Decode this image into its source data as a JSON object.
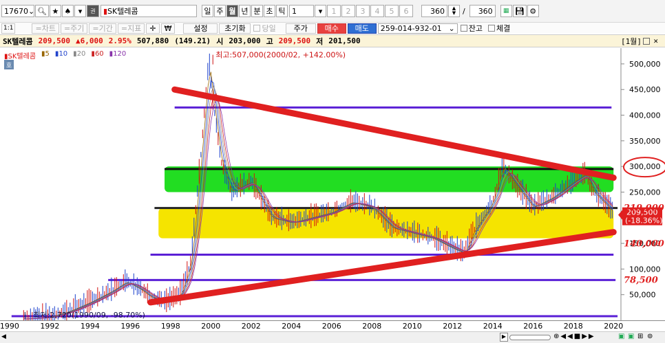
{
  "toolbar": {
    "code": "17670",
    "stock_name": "SK텔레콤",
    "period_tabs": [
      "일",
      "주",
      "월",
      "년",
      "분",
      "초",
      "틱"
    ],
    "active_period": "월",
    "interval_value": "1",
    "page_numbers": [
      "1",
      "2",
      "3",
      "4",
      "5",
      "6"
    ],
    "count_value": "360",
    "count_total": "360",
    "slash": "/"
  },
  "toolbar2": {
    "page": "1:1",
    "chart_btn": "=차트",
    "period_btn": "=주기",
    "range_btn": "=기간",
    "indicator_btn": "=지표",
    "settings_btn": "설정",
    "reset_btn": "초기화",
    "today_label": "당일",
    "price_btn": "주가",
    "buy_btn": "매수",
    "sell_btn": "매도",
    "account": "259-014-932-01",
    "balance_label": "잔고",
    "filled_label": "체결"
  },
  "quote": {
    "name": "SK텔레콤",
    "price": "209,500",
    "change": "▲6,000",
    "rate": "2.95%",
    "volume": "507,880",
    "volume_ratio": "(149.21)",
    "open_label": "시",
    "open": "203,000",
    "high_label": "고",
    "high": "209,500",
    "low_label": "저",
    "low": "201,500",
    "window_label": "[1월]"
  },
  "legend": {
    "name": "SK텔레콤",
    "ma": [
      "5",
      "10",
      "20",
      "60",
      "120"
    ]
  },
  "chart_data": {
    "type": "line",
    "title": "SK텔레콤",
    "x_ticks": [
      "1990",
      "1992",
      "1994",
      "1996",
      "1998",
      "2000",
      "2002",
      "2004",
      "2006",
      "2008",
      "2010",
      "2012",
      "2014",
      "2016",
      "2018",
      "2020"
    ],
    "y_ticks": [
      "500,000",
      "450,000",
      "400,000",
      "350,000",
      "300,000",
      "250,000",
      "200,000",
      "150,000",
      "100,000",
      "50,000"
    ],
    "ylim": [
      0,
      520000
    ],
    "xlim": [
      1989.8,
      2020.3
    ],
    "x": [
      1990.7,
      1992,
      1993,
      1994,
      1995,
      1995.8,
      1996.5,
      1997,
      1997.8,
      1998.5,
      1999,
      1999.5,
      1999.9,
      2000.1,
      2000.5,
      2001,
      2002,
      2003,
      2004,
      2005,
      2006,
      2007,
      2008,
      2009,
      2010,
      2011,
      2012,
      2012.6,
      2013,
      2014,
      2014.5,
      2015,
      2016,
      2017,
      2018,
      2018.6,
      2019,
      2020
    ],
    "y": [
      2720,
      6000,
      18000,
      35000,
      55000,
      75000,
      60000,
      45000,
      35000,
      50000,
      110000,
      320000,
      507000,
      430000,
      310000,
      250000,
      270000,
      200000,
      190000,
      200000,
      210000,
      230000,
      220000,
      180000,
      170000,
      160000,
      140000,
      130000,
      170000,
      230000,
      300000,
      270000,
      220000,
      240000,
      270000,
      285000,
      250000,
      209500
    ],
    "annotations": {
      "high": "최고:507,000(2000/02, +142.00%)",
      "low": "최저:2,720(1990/09, -98.70%)",
      "current_price": "209,500",
      "current_rate": "(-18.36%)",
      "handwritten": [
        "219,000",
        "140,000",
        "78,500"
      ]
    },
    "horizontal_lines": [
      415000,
      295000,
      219000,
      128000,
      78500,
      8000
    ],
    "trend_high": [
      [
        1998.2,
        450000
      ],
      [
        2020,
        278000
      ]
    ],
    "trend_low": [
      [
        1997,
        35000
      ],
      [
        2020,
        172000
      ]
    ],
    "green_band": [
      250000,
      300000
    ],
    "yellow_band": [
      160000,
      219000
    ],
    "colors": {
      "up": "#d11111",
      "down": "#1a3fcc",
      "trend": "#e02020",
      "hline": "#5a1fd6",
      "green_band": "#22dd22",
      "yellow_band": "#f5e400",
      "circle": "#e02020"
    }
  },
  "status": {
    "zoom_marks": "◀ ▶"
  }
}
